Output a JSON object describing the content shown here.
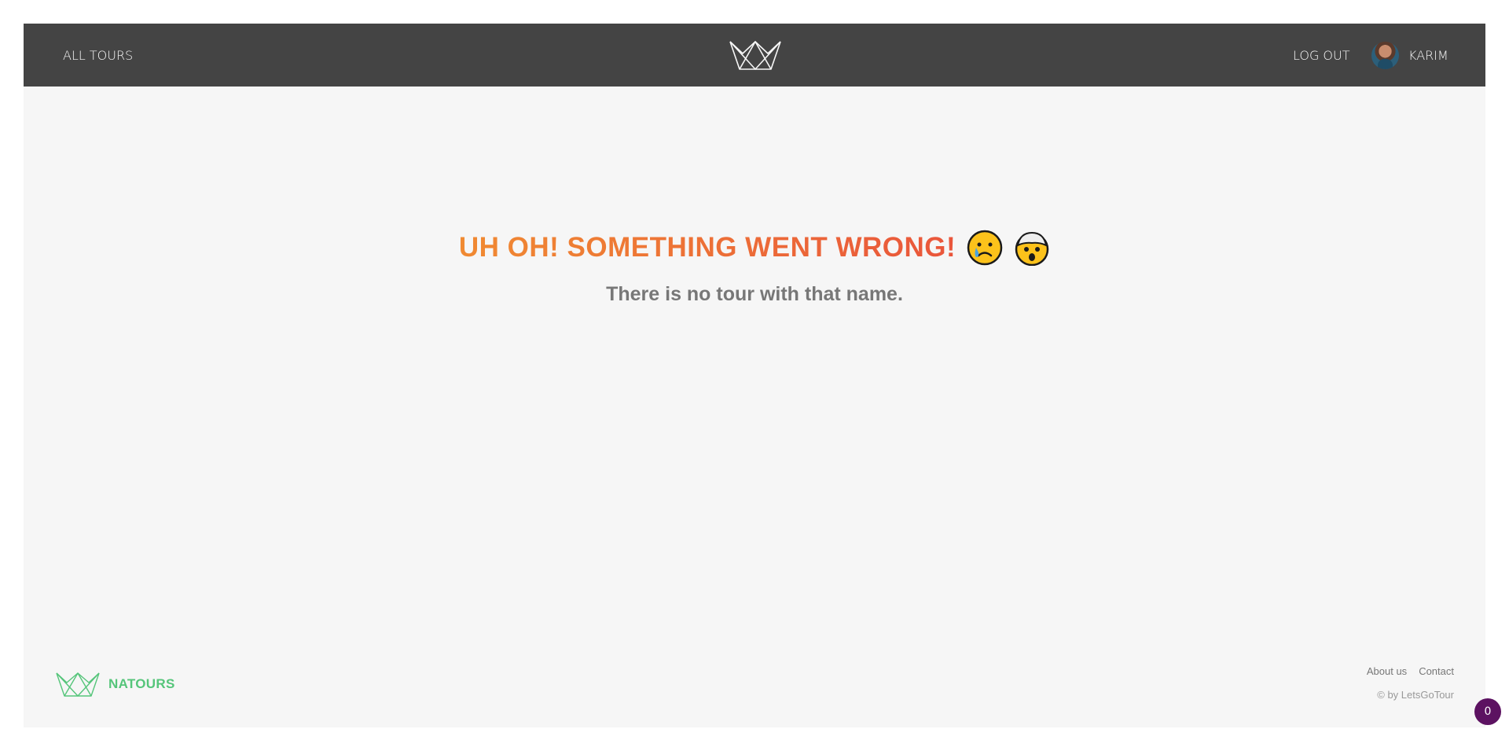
{
  "header": {
    "all_tours": "All tours",
    "logout": "Log out",
    "user_name": "Karim",
    "logo_icon": "natours-crown-logo-icon",
    "avatar_icon": "user-avatar"
  },
  "error": {
    "title": "Uh oh! Something went wrong!",
    "emoji_1": "crying-face-emoji-icon",
    "emoji_2": "exploding-head-emoji-icon",
    "message": "There is no tour with that name."
  },
  "footer": {
    "brand": "NATOURS",
    "logo_icon": "natours-crown-logo-icon",
    "links": [
      "About us",
      "Contact"
    ],
    "copyright": "© by LetsGoTour"
  },
  "badge": {
    "count": "0"
  },
  "colors": {
    "header_bg": "#444444",
    "page_bg": "#f6f6f6",
    "error_gradient_start": "#f08a32",
    "error_gradient_end": "#e84c3d",
    "brand_green": "#55c57a",
    "badge_bg": "#5c1261"
  }
}
